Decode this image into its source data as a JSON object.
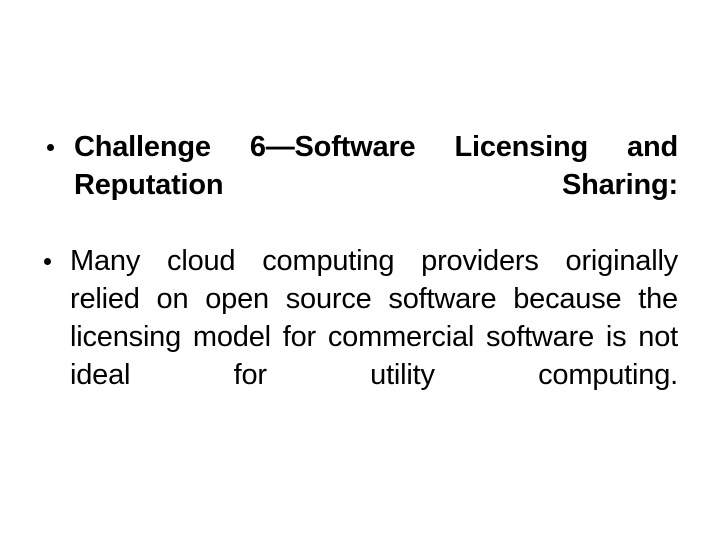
{
  "slide": {
    "background_color": "#ffffff",
    "text_color": "#000000",
    "bullets": [
      {
        "marker": "round-bullet",
        "emphasis": "bold",
        "text": "Challenge 6—Software Licensing and Reputation Sharing:"
      },
      {
        "marker": "round-bullet",
        "emphasis": "normal",
        "text": "Many cloud computing providers originally relied on open source software because the licensing model for commercial software is not ideal for utility computing."
      }
    ]
  }
}
